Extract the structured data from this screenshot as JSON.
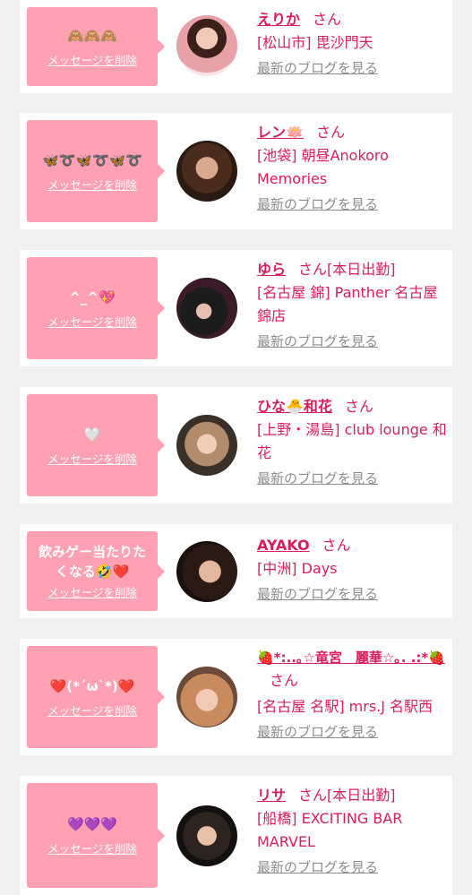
{
  "delete_label": "メッセージを削除",
  "blog_link": "最新のブログを見る",
  "san": "さん",
  "cards": [
    {
      "message": "🙈🙈🙈",
      "name": "えりか",
      "shop": "[松山市] 毘沙門天",
      "extra": ""
    },
    {
      "message": "🦋➰🦋➰🦋➰",
      "name": "レン🪷",
      "shop": "[池袋] 朝昼Anokoro Memories",
      "extra": ""
    },
    {
      "message": "^_^💖",
      "name": "ゆら",
      "shop": "[名古屋 錦] Panther 名古屋錦店",
      "extra": "[本日出勤]"
    },
    {
      "message": "🤍",
      "name": "ひな🐣和花",
      "shop": "[上野・湯島] club lounge 和花",
      "extra": ""
    },
    {
      "message": "飲みゲー当たりたくなる🤣❤️",
      "name": "AYAKO",
      "shop": "[中洲] Days",
      "extra": ""
    },
    {
      "message": "❤️(*´ω`*)❤️",
      "name": "🍓*:..｡☆竜宮　麗華☆｡. .:*🍓",
      "shop": "[名古屋 名駅] mrs.J 名駅西",
      "extra": ""
    },
    {
      "message": "💜💜💜",
      "name": "リサ",
      "shop": "[船橋] EXCITING BAR MARVEL",
      "extra": "[本日出勤]"
    }
  ],
  "colors": {
    "accent": "#d81e5b",
    "bubble": "#ffa0b3"
  }
}
